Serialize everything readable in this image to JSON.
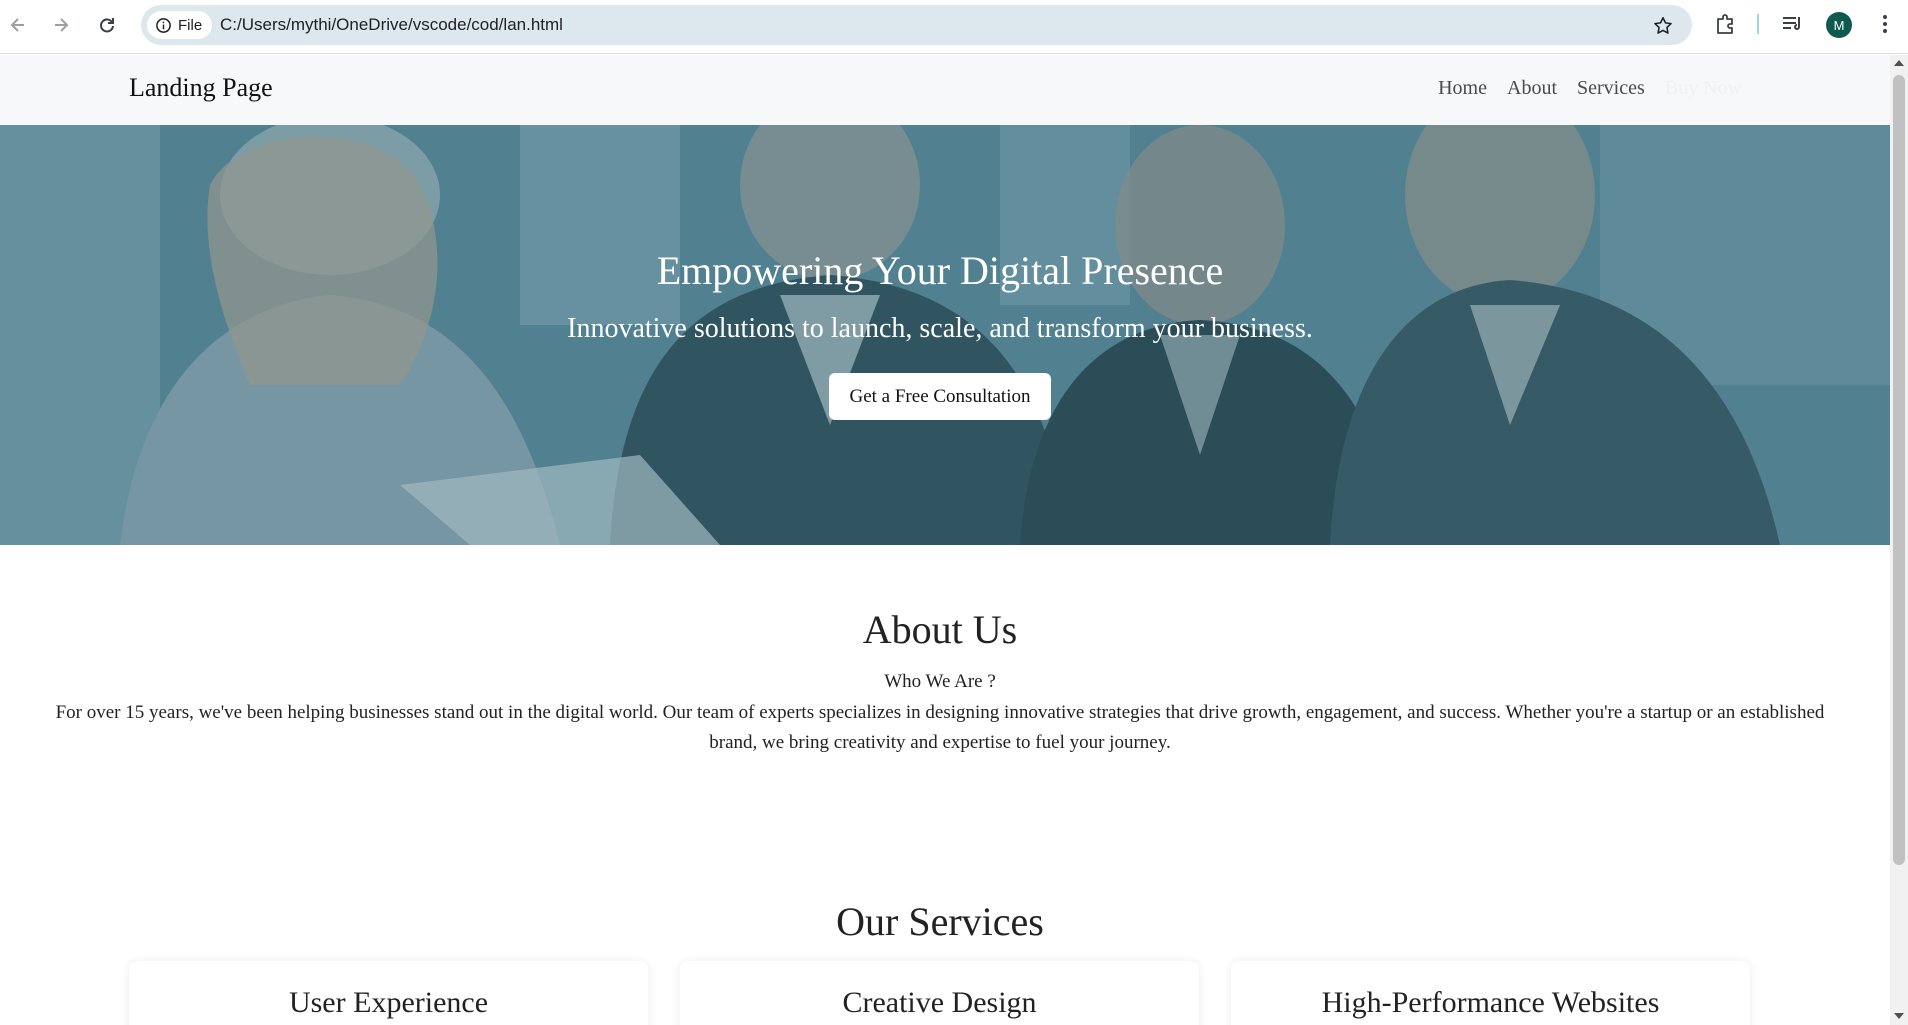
{
  "browser": {
    "chip_label": "File",
    "url": "C:/Users/mythi/OneDrive/vscode/cod/lan.html",
    "avatar_letter": "M"
  },
  "site": {
    "brand": "Landing Page",
    "nav": [
      "Home",
      "About",
      "Services",
      "Buy Now"
    ]
  },
  "hero": {
    "title": "Empowering Your Digital Presence",
    "subtitle": "Innovative solutions to launch, scale, and transform your business.",
    "cta": "Get a Free Consultation"
  },
  "about": {
    "title": "About Us",
    "subtitle": "Who We Are ?",
    "text": "For over 15 years, we've been helping businesses stand out in the digital world. Our team of experts specializes in designing innovative strategies that drive growth, engagement, and success. Whether you're a startup or an established brand, we bring creativity and expertise to fuel your journey."
  },
  "services": {
    "title": "Our Services",
    "cards": [
      "User Experience",
      "Creative Design",
      "High-Performance Websites"
    ]
  },
  "colors": {
    "hero_tint": "#3f6f7e",
    "nav_bg": "#f6f8fa",
    "omnibox_bg": "#dde8ee",
    "avatar_bg": "#0f5a4e"
  }
}
